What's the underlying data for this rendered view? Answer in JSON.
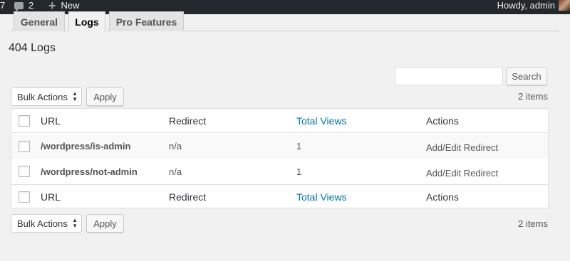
{
  "adminbar": {
    "left_number": "7",
    "comments_count": "2",
    "new_label": "New",
    "greeting": "Howdy, admin"
  },
  "tabs": [
    {
      "label": "General",
      "active": false
    },
    {
      "label": "Logs",
      "active": true
    },
    {
      "label": "Pro Features",
      "active": false
    }
  ],
  "page_title": "404 Logs",
  "search": {
    "value": "",
    "button_label": "Search"
  },
  "bulk_actions": {
    "selected": "Bulk Actions",
    "apply_label": "Apply"
  },
  "items_count": "2 items",
  "table": {
    "columns": [
      "URL",
      "Redirect",
      "Total Views",
      "Actions"
    ],
    "rows": [
      {
        "url": "/wordpress/is-admin",
        "redirect": "n/a",
        "views": "1",
        "action": "Add/Edit Redirect"
      },
      {
        "url": "/wordpress/not-admin",
        "redirect": "n/a",
        "views": "1",
        "action": "Add/Edit Redirect"
      }
    ]
  },
  "colors": {
    "link": "#0073aa",
    "adminbar": "#23282d",
    "background": "#f1f1f1"
  }
}
